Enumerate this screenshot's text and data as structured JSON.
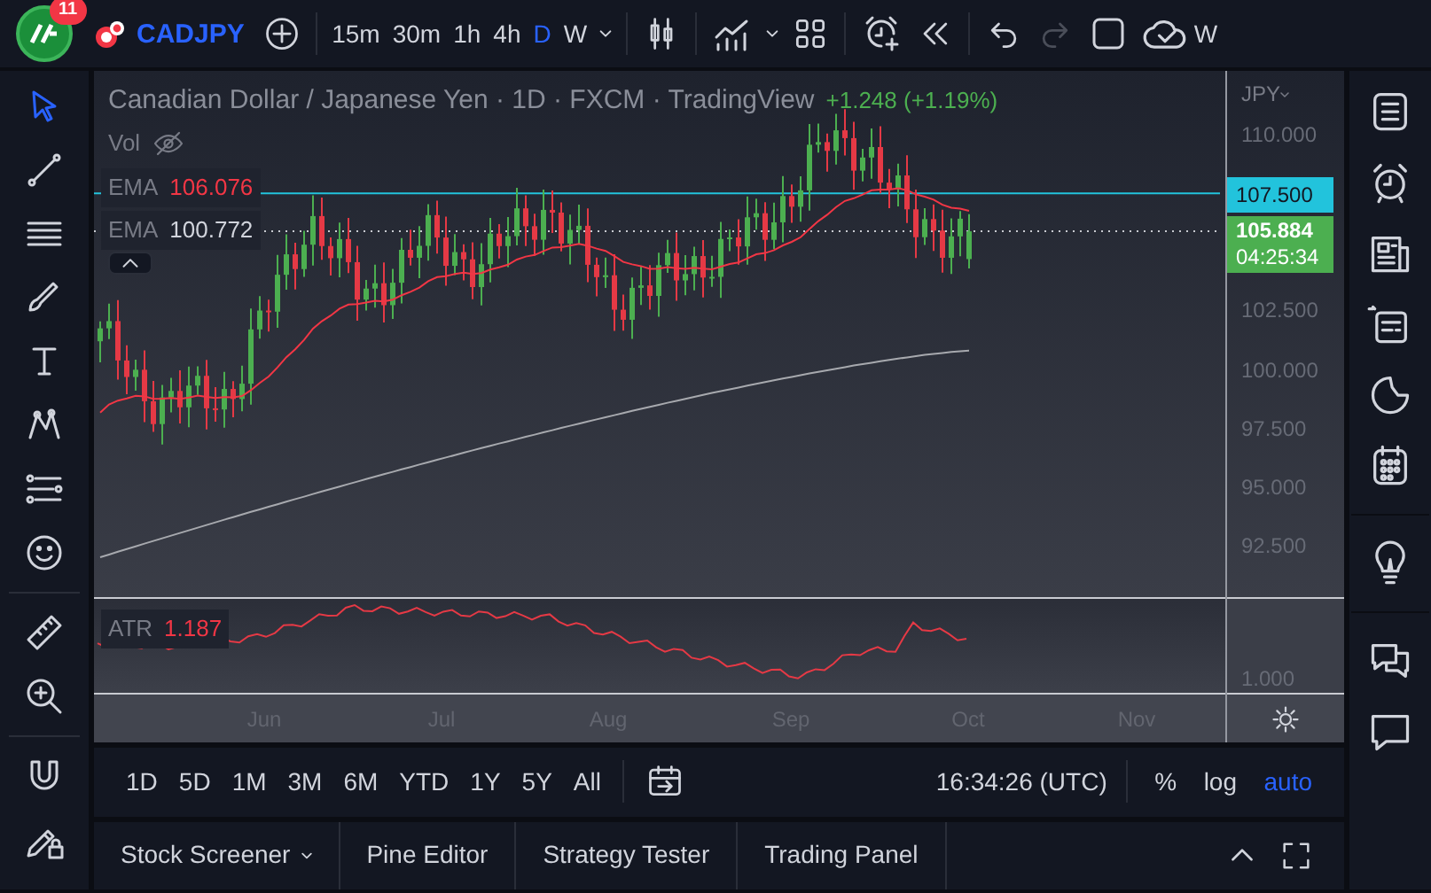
{
  "header": {
    "notification_count": "11",
    "symbol": "CADJPY",
    "intervals": [
      {
        "label": "15m",
        "selected": false
      },
      {
        "label": "30m",
        "selected": false
      },
      {
        "label": "1h",
        "selected": false
      },
      {
        "label": "4h",
        "selected": false
      },
      {
        "label": "D",
        "selected": true
      },
      {
        "label": "W",
        "selected": false
      }
    ],
    "history": [
      {
        "kind": "undo",
        "disabled": false
      },
      {
        "kind": "redo",
        "disabled": true
      }
    ],
    "cut_label": "W"
  },
  "left_toolbar": [
    {
      "kind": "cursor",
      "selected": true
    },
    {
      "kind": "trendline",
      "selected": false
    },
    {
      "kind": "fib",
      "selected": false
    },
    {
      "kind": "brush",
      "selected": false
    },
    {
      "kind": "text",
      "selected": false
    },
    {
      "kind": "pattern",
      "selected": false
    },
    {
      "kind": "measure",
      "selected": false
    },
    {
      "kind": "smiley",
      "selected": false
    },
    {
      "kind": "ruler",
      "selected": false
    },
    {
      "kind": "zoom",
      "selected": false
    },
    {
      "kind": "magnet",
      "selected": false
    },
    {
      "kind": "lock",
      "selected": false
    }
  ],
  "chart": {
    "title": "Canadian Dollar / Japanese Yen · 1D · FXCM · TradingView",
    "change": "+1.248 (+1.19%)",
    "volume_label": "Vol",
    "emas": [
      {
        "label": "EMA",
        "value": "106.076",
        "color": "#f23645"
      },
      {
        "label": "EMA",
        "value": "100.772",
        "color": "#d1d4dc"
      }
    ]
  },
  "price_axis": {
    "currency": "JPY",
    "ticks": [
      "110.000",
      "102.500",
      "100.000",
      "97.500",
      "95.000",
      "92.500"
    ],
    "level_label": "107.500",
    "last_price": "105.884",
    "countdown": "04:25:34"
  },
  "atr": {
    "label": "ATR",
    "value": "1.187",
    "axis_tick": "1.000"
  },
  "time_axis": [
    "Jun",
    "Jul",
    "Aug",
    "Sep",
    "Oct",
    "Nov"
  ],
  "range_bar": {
    "ranges": [
      "1D",
      "5D",
      "1M",
      "3M",
      "6M",
      "YTD",
      "1Y",
      "5Y",
      "All"
    ],
    "clock": "16:34:26 (UTC)",
    "scale_options": [
      {
        "label": "%",
        "selected": false
      },
      {
        "label": "log",
        "selected": false
      },
      {
        "label": "auto",
        "selected": true
      }
    ]
  },
  "bottom_tabs": [
    {
      "label": "Stock Screener",
      "dropdown": true
    },
    {
      "label": "Pine Editor",
      "dropdown": false
    },
    {
      "label": "Strategy Tester",
      "dropdown": false
    },
    {
      "label": "Trading Panel",
      "dropdown": false
    }
  ],
  "right_sidebar": [
    {
      "kind": "watchlist"
    },
    {
      "kind": "alarm"
    },
    {
      "kind": "news"
    },
    {
      "kind": "datawindow"
    },
    {
      "kind": "dial"
    },
    {
      "kind": "calendar"
    },
    {
      "kind": "bulb"
    },
    {
      "kind": "chats"
    },
    {
      "kind": "chat"
    }
  ]
}
